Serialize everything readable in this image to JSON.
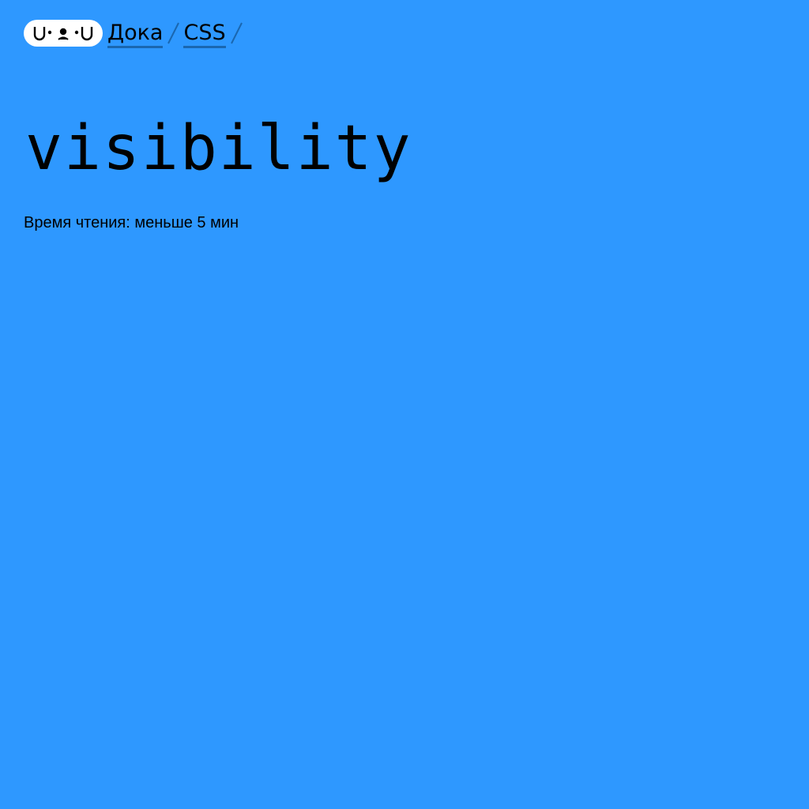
{
  "header": {
    "logo_icon": "doka-logo-icon",
    "breadcrumbs": [
      {
        "label": "Дока"
      },
      {
        "label": "CSS"
      }
    ],
    "separator_icon": "slash-separator-icon"
  },
  "article": {
    "title": "visibility",
    "reading_time": "Время чтения: меньше 5 мин"
  },
  "colors": {
    "background": "#2e98ff",
    "text": "#000000",
    "logo_background": "#ffffff",
    "link_underline": "#1a67b0"
  }
}
